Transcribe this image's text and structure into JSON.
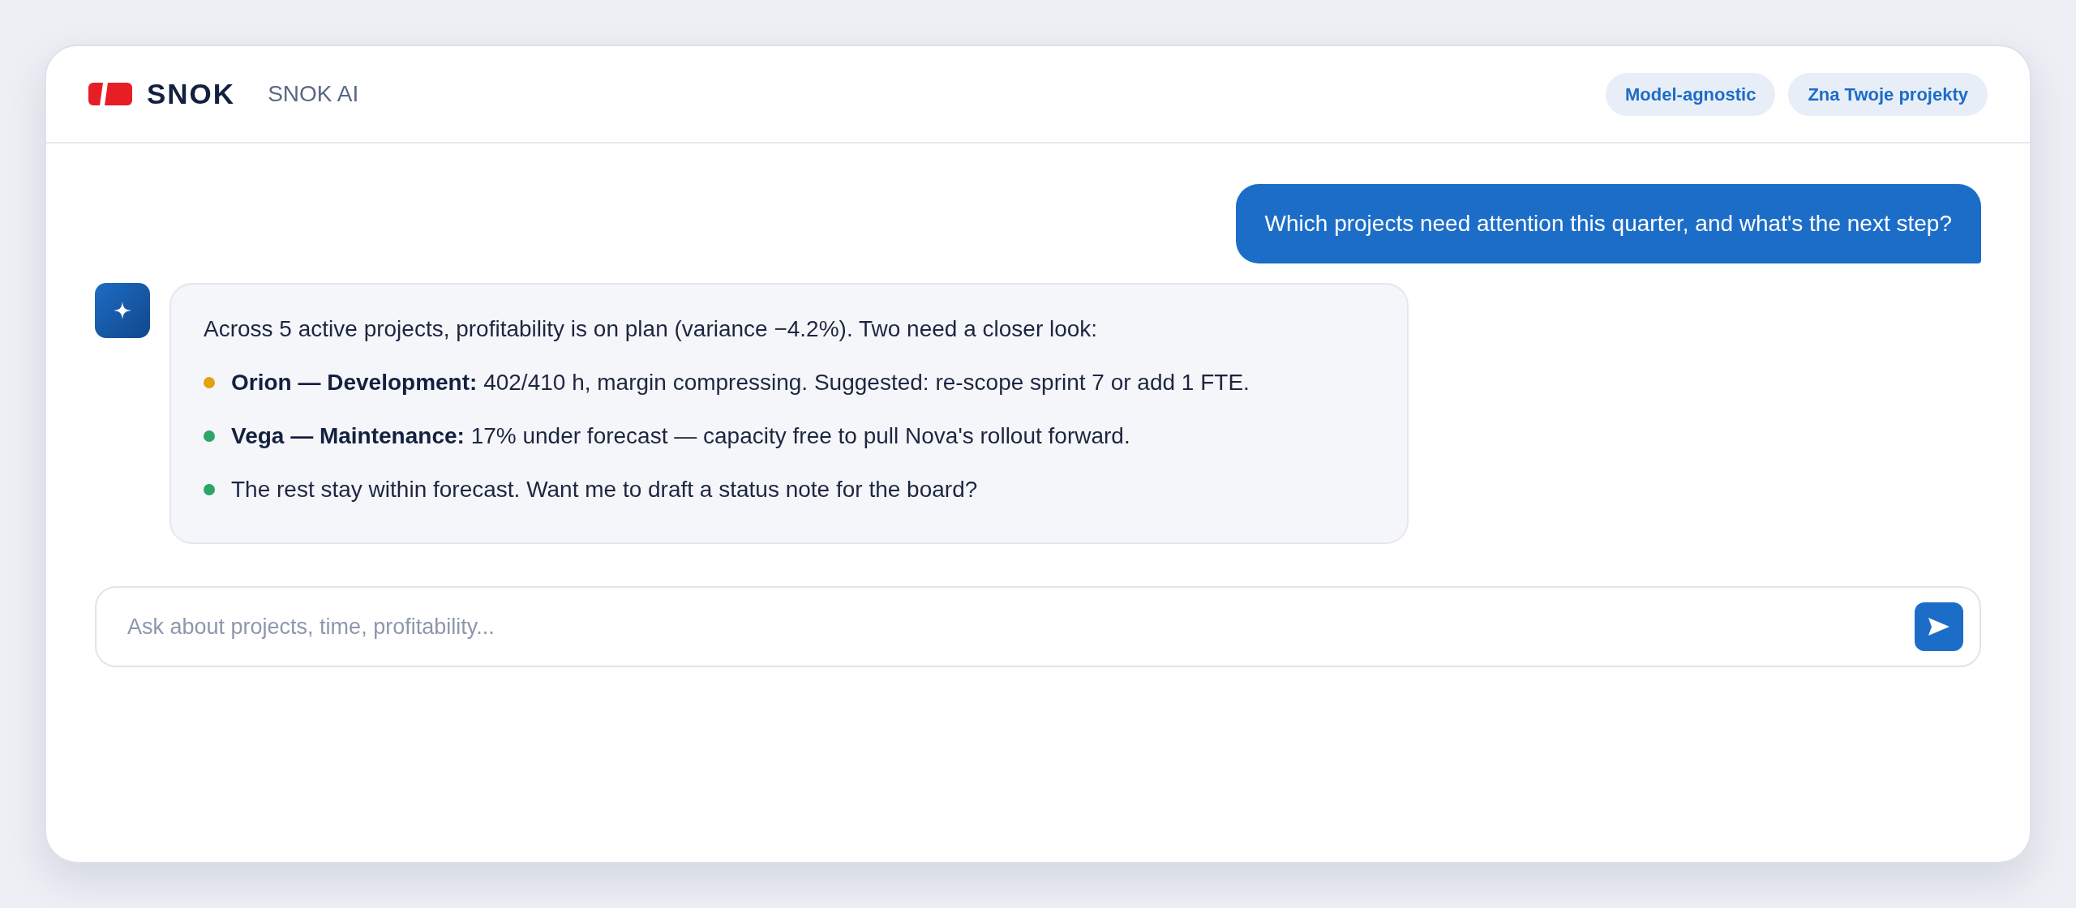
{
  "header": {
    "brand": "SNOK",
    "product": "SNOK AI",
    "badges": [
      "Model-agnostic",
      "Zna Twoje projekty"
    ]
  },
  "messages": [
    {
      "kind": "user",
      "text": "Which projects need attention this quarter, and what's the next step?"
    },
    {
      "kind": "assistant",
      "intro": "Across 5 active projects, profitability is on plan (variance −4.2%). Two need a closer look:",
      "points": [
        {
          "text": "**Orion — Development:** 402/410 h, margin compressing. Suggested: re-scope sprint 7 or add 1 FTE.",
          "color": "#e5a00d"
        },
        {
          "text": "**Vega — Maintenance:** 17% under forecast — capacity free to pull Nova's rollout forward.",
          "color": "#2ea568"
        },
        {
          "text": "The rest stay within forecast. Want me to draft a status note for the board?",
          "color": "#2ea568"
        }
      ]
    }
  ],
  "composer": {
    "placeholder": "Ask about projects, time, profitability..."
  }
}
